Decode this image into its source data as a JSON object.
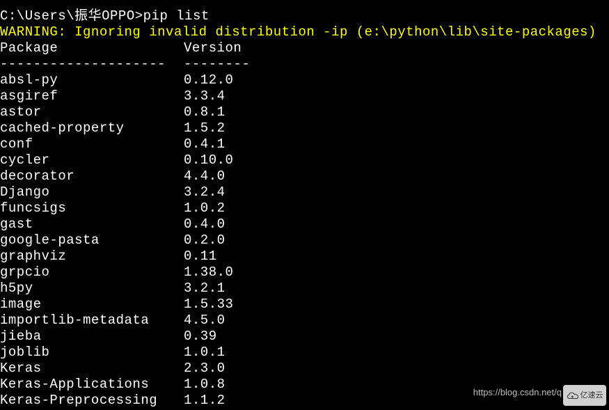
{
  "prompt": {
    "path": "C:\\Users\\振华OPPO>",
    "command": "pip list"
  },
  "warning": "WARNING: Ignoring invalid distribution -ip (e:\\python\\lib\\site-packages)",
  "header": {
    "package_col": "Package",
    "version_col": "Version"
  },
  "divider": {
    "package_col": "--------------------",
    "version_col": "--------"
  },
  "packages": [
    {
      "name": "absl-py",
      "version": "0.12.0"
    },
    {
      "name": "asgiref",
      "version": "3.3.4"
    },
    {
      "name": "astor",
      "version": "0.8.1"
    },
    {
      "name": "cached-property",
      "version": "1.5.2"
    },
    {
      "name": "conf",
      "version": "0.4.1"
    },
    {
      "name": "cycler",
      "version": "0.10.0"
    },
    {
      "name": "decorator",
      "version": "4.4.0"
    },
    {
      "name": "Django",
      "version": "3.2.4"
    },
    {
      "name": "funcsigs",
      "version": "1.0.2"
    },
    {
      "name": "gast",
      "version": "0.4.0"
    },
    {
      "name": "google-pasta",
      "version": "0.2.0"
    },
    {
      "name": "graphviz",
      "version": "0.11"
    },
    {
      "name": "grpcio",
      "version": "1.38.0"
    },
    {
      "name": "h5py",
      "version": "3.2.1"
    },
    {
      "name": "image",
      "version": "1.5.33"
    },
    {
      "name": "importlib-metadata",
      "version": "4.5.0"
    },
    {
      "name": "jieba",
      "version": "0.39"
    },
    {
      "name": "joblib",
      "version": "1.0.1"
    },
    {
      "name": "Keras",
      "version": "2.3.0"
    },
    {
      "name": "Keras-Applications",
      "version": "1.0.8"
    },
    {
      "name": "Keras-Preprocessing",
      "version": "1.1.2"
    }
  ],
  "watermark": {
    "url": "https://blog.csdn.net/q",
    "logo_text": "亿速云"
  }
}
